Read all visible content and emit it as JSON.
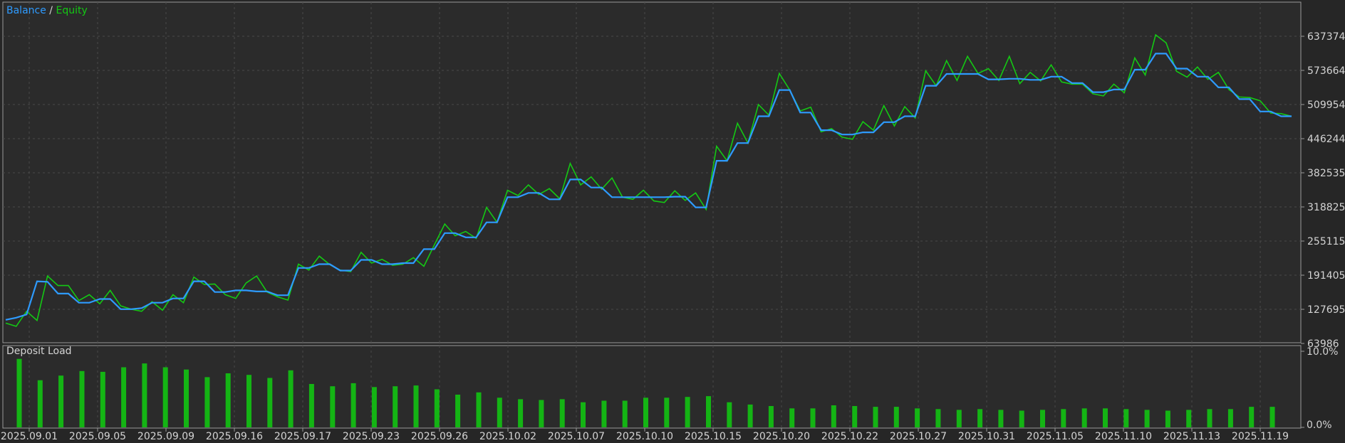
{
  "legend": {
    "balance_label": "Balance",
    "separator": " / ",
    "equity_label": "Equity"
  },
  "colors": {
    "background": "#2b2b2b",
    "grid": "#4a4a4a",
    "balance": "#2e9bff",
    "equity": "#14c814",
    "bars": "#14b414",
    "text": "#d4d4d4"
  },
  "chart_data": [
    {
      "type": "line",
      "title": "",
      "series": [
        {
          "name": "Balance",
          "values": [
            108000,
            112000,
            118000,
            180000,
            179000,
            157000,
            157000,
            140000,
            140000,
            147000,
            147000,
            128000,
            128000,
            130000,
            140000,
            140000,
            148000,
            148000,
            180000,
            180000,
            160000,
            160000,
            163000,
            163000,
            161000,
            161000,
            154000,
            154000,
            205000,
            205000,
            212000,
            212000,
            200000,
            200000,
            220000,
            220000,
            212000,
            212000,
            214000,
            214000,
            240000,
            240000,
            270000,
            270000,
            262000,
            262000,
            290000,
            290000,
            337000,
            337000,
            345000,
            345000,
            333000,
            333000,
            370000,
            370000,
            355000,
            355000,
            337000,
            337000,
            337000,
            337000,
            337000,
            337000,
            338000,
            338000,
            318000,
            318000,
            405000,
            405000,
            438000,
            438000,
            488000,
            488000,
            537000,
            537000,
            495000,
            495000,
            462000,
            462000,
            454000,
            454000,
            458000,
            458000,
            477000,
            477000,
            488000,
            488000,
            545000,
            545000,
            567000,
            567000,
            567000,
            567000,
            557000,
            557000,
            558000,
            558000,
            556000,
            556000,
            562000,
            562000,
            550000,
            550000,
            533000,
            533000,
            538000,
            538000,
            575000,
            575000,
            605000,
            605000,
            577000,
            577000,
            562000,
            562000,
            542000,
            542000,
            520000,
            520000,
            497000,
            497000,
            488000,
            488000
          ]
        },
        {
          "name": "Equity",
          "values": [
            102000,
            96000,
            124000,
            107000,
            190000,
            172000,
            172000,
            144000,
            155000,
            138000,
            163000,
            134000,
            128000,
            124000,
            142000,
            126000,
            155000,
            140000,
            188000,
            174000,
            175000,
            155000,
            148000,
            177000,
            190000,
            160000,
            151000,
            145000,
            212000,
            201000,
            227000,
            211000,
            201000,
            198000,
            234000,
            214000,
            221000,
            210000,
            212000,
            224000,
            208000,
            248000,
            287000,
            265000,
            273000,
            260000,
            318000,
            290000,
            350000,
            340000,
            360000,
            342000,
            353000,
            334000,
            400000,
            360000,
            375000,
            352000,
            373000,
            337000,
            333000,
            350000,
            330000,
            327000,
            349000,
            331000,
            345000,
            314000,
            432000,
            405000,
            475000,
            438000,
            510000,
            490000,
            568000,
            537000,
            498000,
            505000,
            459000,
            465000,
            449000,
            445000,
            478000,
            462000,
            508000,
            470000,
            506000,
            485000,
            573000,
            545000,
            592000,
            555000,
            600000,
            568000,
            577000,
            555000,
            600000,
            549000,
            570000,
            554000,
            584000,
            552000,
            548000,
            548000,
            530000,
            526000,
            548000,
            532000,
            597000,
            565000,
            640000,
            625000,
            572000,
            561000,
            580000,
            557000,
            570000,
            538000,
            524000,
            523000,
            517000,
            494000,
            493000,
            488000
          ]
        }
      ],
      "x_ticks": [
        "2025.09.01",
        "2025.09.05",
        "2025.09.09",
        "2025.09.16",
        "2025.09.17",
        "2025.09.23",
        "2025.09.26",
        "2025.10.02",
        "2025.10.07",
        "2025.10.10",
        "2025.10.15",
        "2025.10.20",
        "2025.10.22",
        "2025.10.27",
        "2025.10.31",
        "2025.11.05",
        "2025.11.10",
        "2025.11.13",
        "2025.11.19"
      ],
      "y_ticks": [
        "637374",
        "573664",
        "509954",
        "446244",
        "382535",
        "318825",
        "255115",
        "191405",
        "127695",
        "63986"
      ],
      "ylim": [
        63986,
        700000
      ],
      "grid": true,
      "legend_position": "top-left"
    },
    {
      "type": "bar",
      "title": "Deposit Load",
      "y_ticks": [
        "10.0%",
        "0.0%"
      ],
      "ylim": [
        0,
        10
      ],
      "values": [
        9.0,
        6.2,
        6.8,
        7.4,
        7.3,
        7.9,
        8.4,
        7.9,
        7.6,
        6.6,
        7.1,
        6.9,
        6.5,
        7.5,
        5.7,
        5.4,
        5.8,
        5.3,
        5.4,
        5.5,
        5.0,
        4.3,
        4.6,
        3.9,
        3.7,
        3.6,
        3.7,
        3.3,
        3.5,
        3.5,
        3.9,
        3.9,
        4.0,
        4.1,
        3.3,
        3.0,
        2.8,
        2.5,
        2.5,
        2.9,
        2.8,
        2.7,
        2.7,
        2.5,
        2.4,
        2.3,
        2.4,
        2.3,
        2.2,
        2.3,
        2.4,
        2.5,
        2.5,
        2.4,
        2.3,
        2.2,
        2.3,
        2.4,
        2.4,
        2.7,
        2.7
      ]
    }
  ]
}
